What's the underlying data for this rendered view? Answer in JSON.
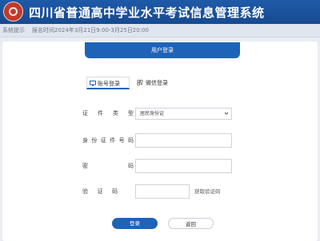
{
  "header": {
    "title": "四川省普通高中学业水平考试信息管理系统",
    "logo_icon": "seal-logo-icon"
  },
  "notice": {
    "label": "系统提示",
    "text": "报名时间2024年3月21日9:00-3月25日20:00"
  },
  "login": {
    "header_title": "用户登录",
    "tabs": [
      {
        "label": "账号登录",
        "icon": "monitor-icon",
        "active": true
      },
      {
        "label": "微信登录",
        "icon": "qr-code-icon",
        "active": false
      }
    ],
    "fields": {
      "id_type": {
        "label": "证件类型",
        "value": "居民身份证"
      },
      "id_number": {
        "label": "身份证件号码",
        "value": ""
      },
      "password": {
        "label": "密码",
        "value": ""
      },
      "captcha": {
        "label": "验证码",
        "value": "",
        "link": "获取验证码"
      }
    },
    "buttons": {
      "login": "登录",
      "back": "返回"
    }
  },
  "colors": {
    "primary": "#1e63b8",
    "header": "#1f5aa8",
    "logo": "#c23a2b"
  }
}
